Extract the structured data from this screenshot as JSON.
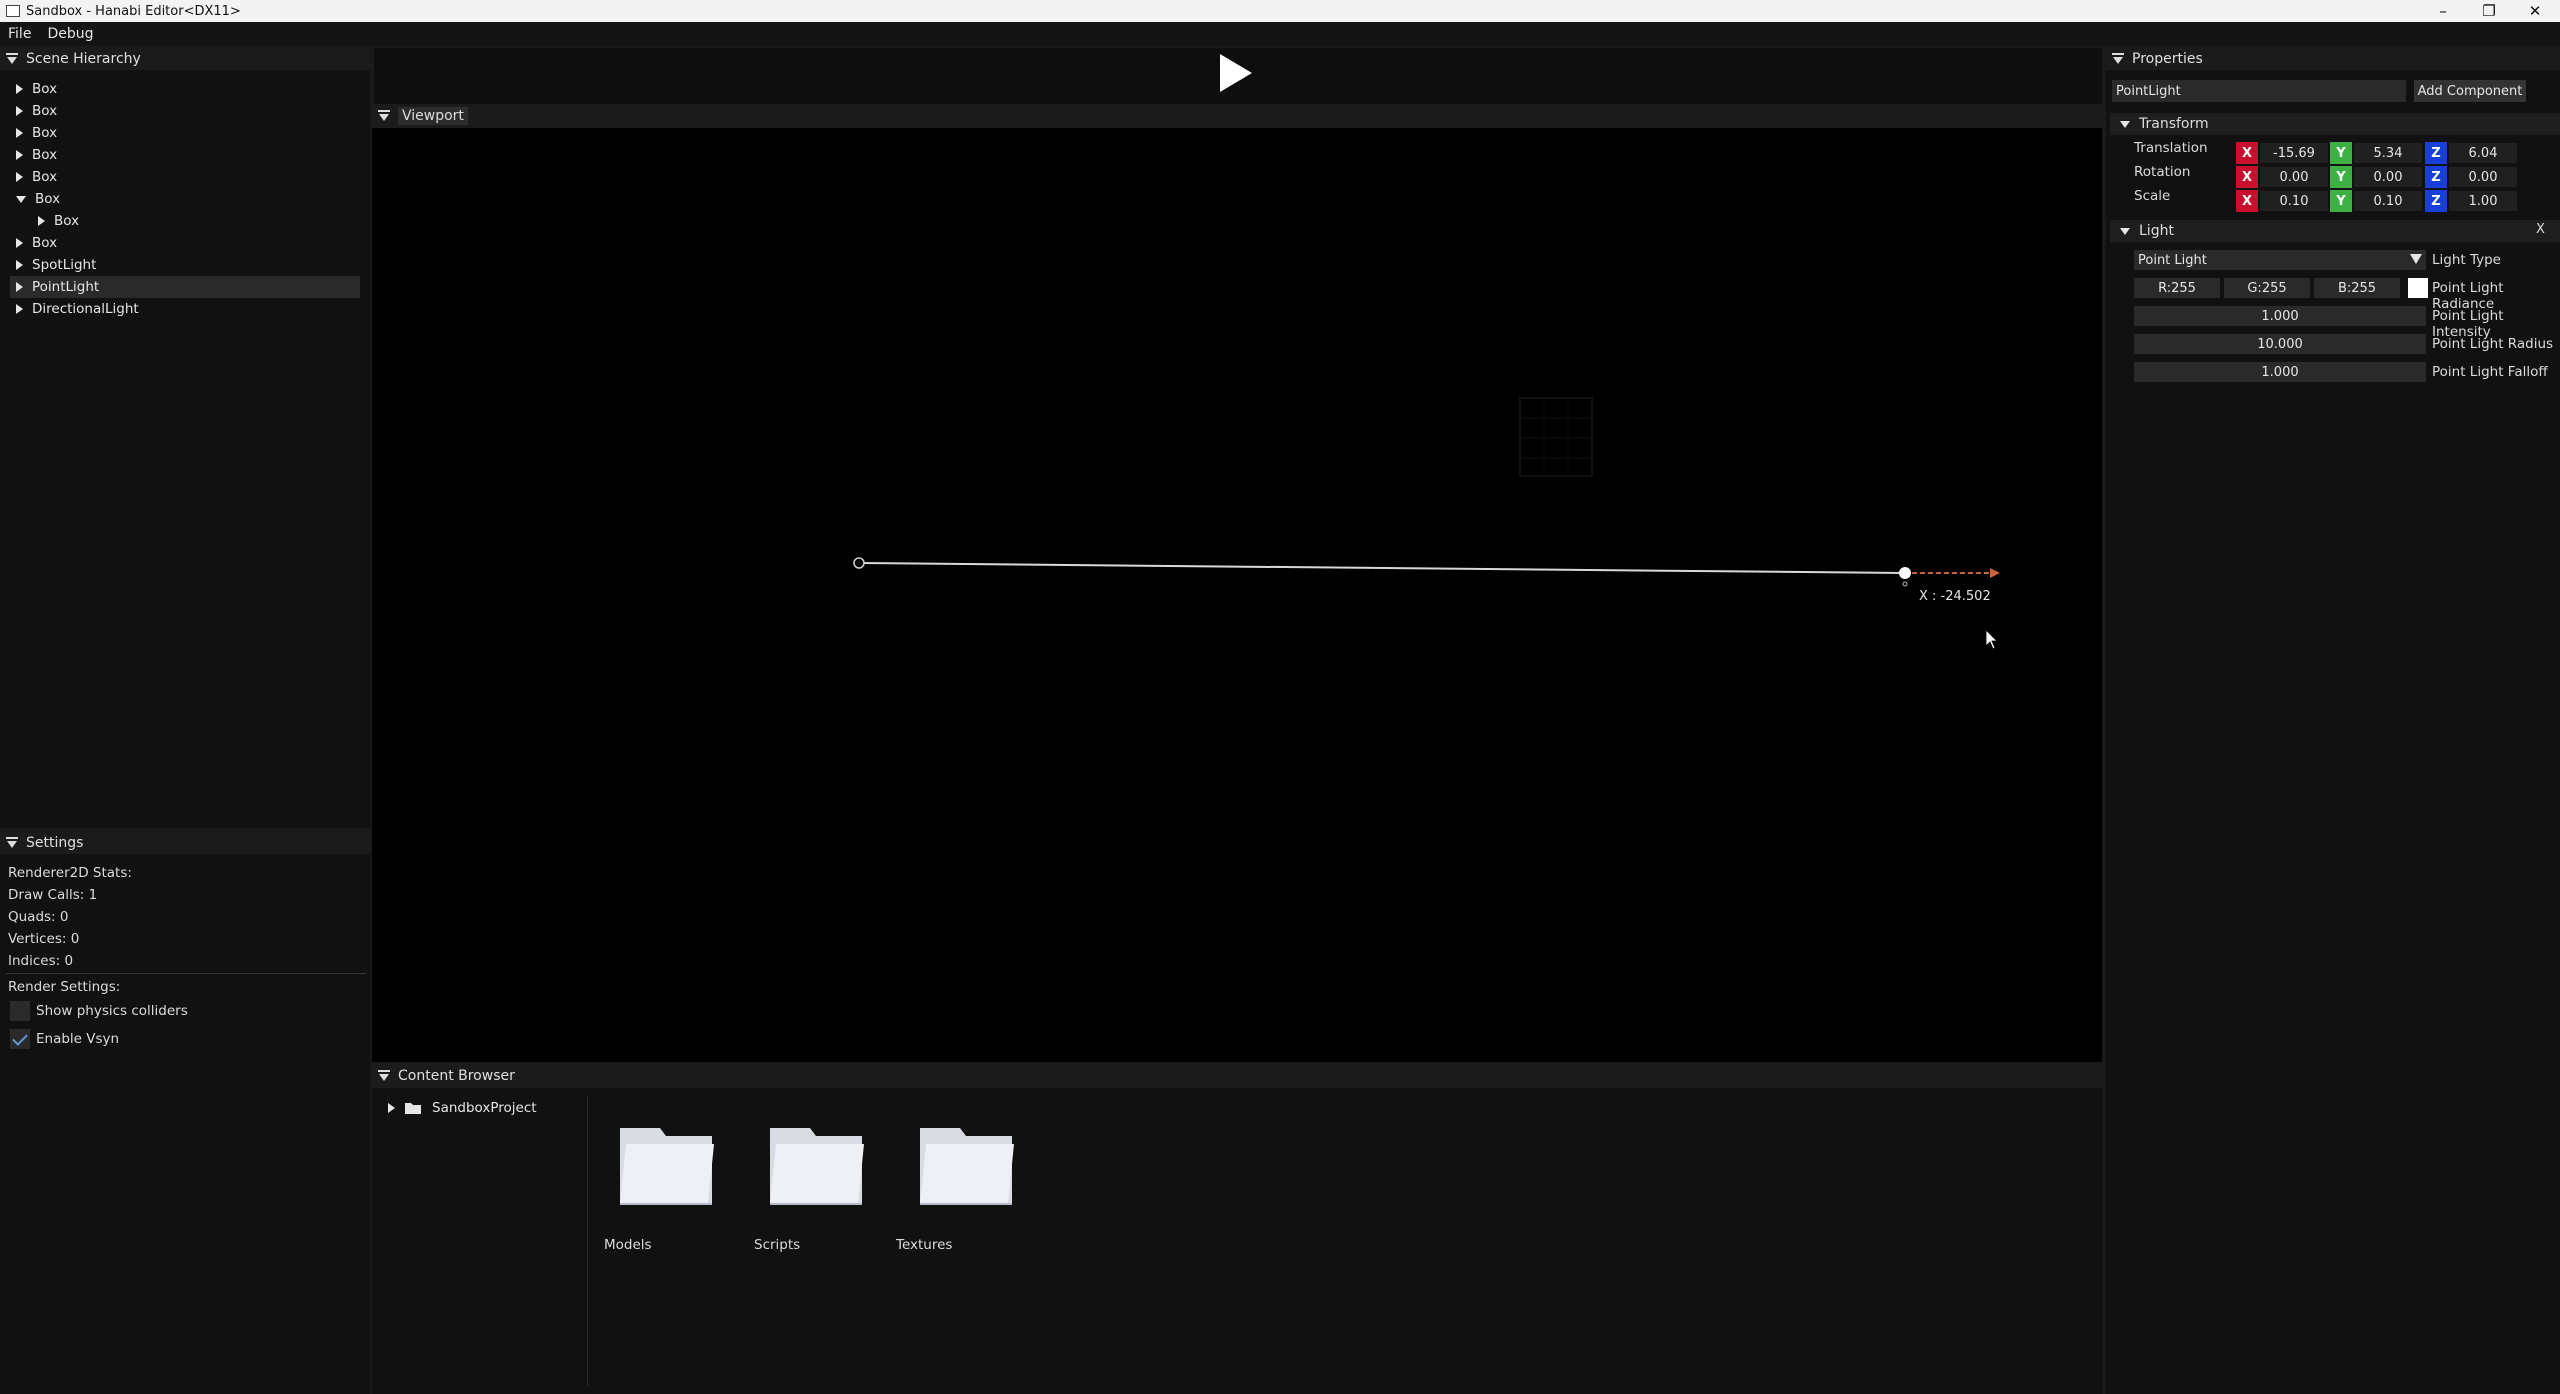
{
  "window": {
    "title": "Sandbox - Hanabi Editor<DX11>",
    "controls": [
      "–",
      "❐",
      "✕"
    ]
  },
  "menu": [
    "File",
    "Debug"
  ],
  "scene_hierarchy": {
    "title": "Scene Hierarchy",
    "items": [
      {
        "label": "Box",
        "expanded": false
      },
      {
        "label": "Box",
        "expanded": false
      },
      {
        "label": "Box",
        "expanded": false
      },
      {
        "label": "Box",
        "expanded": false
      },
      {
        "label": "Box",
        "expanded": false
      },
      {
        "label": "Box",
        "expanded": true
      },
      {
        "label": "Box",
        "expanded": false,
        "child": true
      },
      {
        "label": "Box",
        "expanded": false
      },
      {
        "label": "SpotLight",
        "expanded": false
      },
      {
        "label": "PointLight",
        "expanded": false,
        "selected": true
      },
      {
        "label": "DirectionalLight",
        "expanded": false
      }
    ]
  },
  "settings": {
    "title": "Settings",
    "stats_header": "Renderer2D Stats:",
    "draw_calls": "Draw Calls: 1",
    "quads": "Quads: 0",
    "vertices": "Vertices: 0",
    "indices": "Indices: 0",
    "render_header": "Render Settings:",
    "show_colliders": "Show physics colliders",
    "enable_vsync": "Enable Vsyn"
  },
  "viewport": {
    "title": "Viewport",
    "gizmo_readout": "X : -24.502"
  },
  "content_browser": {
    "title": "Content Browser",
    "root": "SandboxProject",
    "folders": [
      "Models",
      "Scripts",
      "Textures"
    ]
  },
  "properties": {
    "title": "Properties",
    "entity_name": "PointLight",
    "add_component": "Add Component",
    "transform": {
      "title": "Transform",
      "rows": [
        {
          "label": "Translation",
          "x": "-15.69",
          "y": "5.34",
          "z": "6.04"
        },
        {
          "label": "Rotation",
          "x": "0.00",
          "y": "0.00",
          "z": "0.00"
        },
        {
          "label": "Scale",
          "x": "0.10",
          "y": "0.10",
          "z": "1.00"
        }
      ]
    },
    "light": {
      "title": "Light",
      "close": "X",
      "type_value": "Point Light",
      "type_label": "Light Type",
      "r": "R:255",
      "g": "G:255",
      "b": "B:255",
      "radiance_label": "Point Light Radiance",
      "intensity": "1.000",
      "intensity_label": "Point Light Intensity",
      "radius": "10.000",
      "radius_label": "Point Light Radius",
      "falloff": "1.000",
      "falloff_label": "Point Light Falloff"
    }
  },
  "colors": {
    "axis_x": "#c8102e",
    "axis_y": "#3cb043",
    "axis_z": "#1a3fd6",
    "selection": "#2a2a2a",
    "gizmo_arrow": "#c8643c"
  }
}
